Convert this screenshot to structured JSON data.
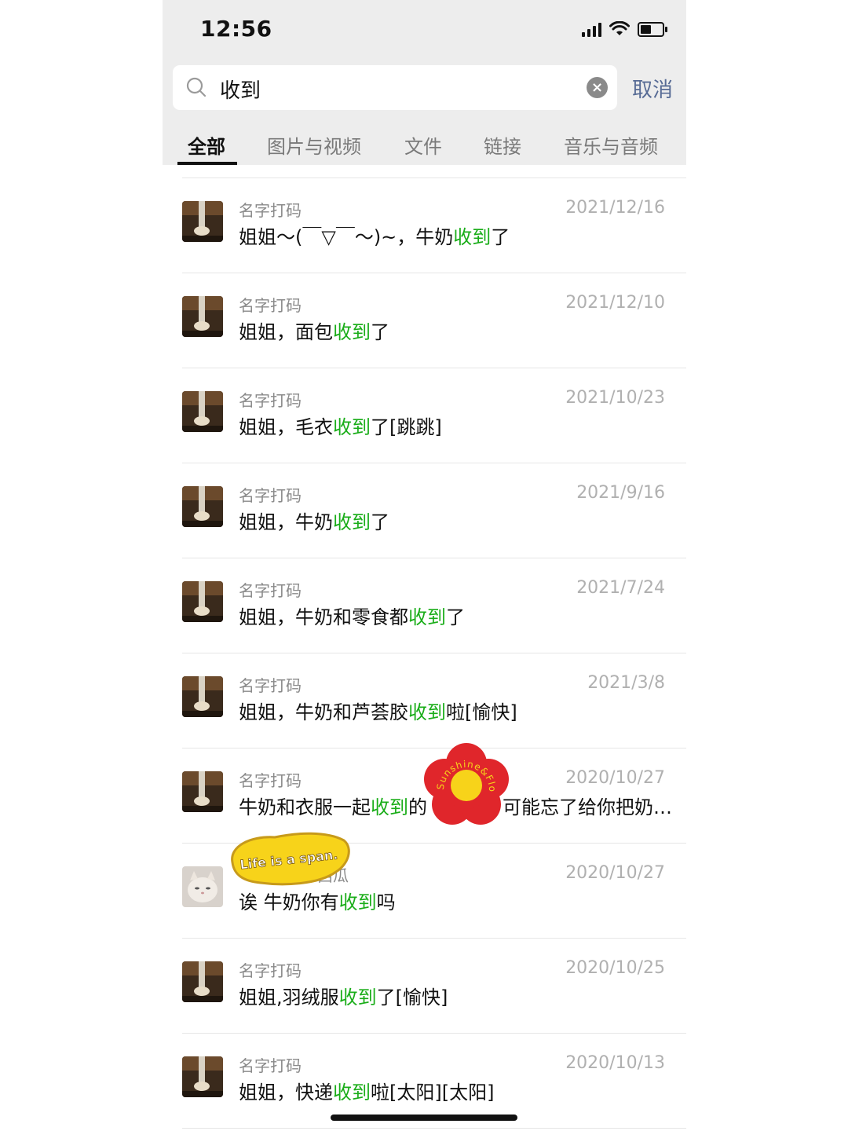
{
  "status_bar": {
    "time": "12:56"
  },
  "search": {
    "query": "收到",
    "cancel_label": "取消"
  },
  "tabs": [
    {
      "label": "全部",
      "active": true
    },
    {
      "label": "图片与视频",
      "active": false
    },
    {
      "label": "文件",
      "active": false
    },
    {
      "label": "链接",
      "active": false
    },
    {
      "label": "音乐与音频",
      "active": false
    }
  ],
  "results": [
    {
      "sender": "名字打码",
      "date": "2021/12/16",
      "pre": "姐姐～(￣▽￣～)~，牛奶",
      "hl": "收到",
      "post": "了",
      "avatar": "dark"
    },
    {
      "sender": "名字打码",
      "date": "2021/12/10",
      "pre": "姐姐，面包",
      "hl": "收到",
      "post": "了",
      "avatar": "dark"
    },
    {
      "sender": "名字打码",
      "date": "2021/10/23",
      "pre": "姐姐，毛衣",
      "hl": "收到",
      "post": "了[跳跳]",
      "avatar": "dark"
    },
    {
      "sender": "名字打码",
      "date": "2021/9/16",
      "pre": "姐姐，牛奶",
      "hl": "收到",
      "post": "了",
      "avatar": "dark"
    },
    {
      "sender": "名字打码",
      "date": "2021/7/24",
      "pre": "姐姐，牛奶和零食都",
      "hl": "收到",
      "post": "了",
      "avatar": "dark"
    },
    {
      "sender": "名字打码",
      "date": "2021/3/8",
      "pre": "姐姐，牛奶和芦荟胶",
      "hl": "收到",
      "post": "啦[愉快]",
      "avatar": "dark"
    },
    {
      "sender": "名字打码",
      "date": "2020/10/27",
      "pre": "牛奶和衣服一起",
      "hl": "收到",
      "post": "的　　　　可能忘了给你把奶…",
      "avatar": "dark"
    },
    {
      "sender": "　　　　　西瓜",
      "date": "2020/10/27",
      "pre": "诶 牛奶你有",
      "hl": "收到",
      "post": "吗",
      "avatar": "cat"
    },
    {
      "sender": "名字打码",
      "date": "2020/10/25",
      "pre": "姐姐,羽绒服",
      "hl": "收到",
      "post": "了[愉快]",
      "avatar": "dark"
    },
    {
      "sender": "名字打码",
      "date": "2020/10/13",
      "pre": "姐姐，快递",
      "hl": "收到",
      "post": "啦[太阳][太阳]",
      "avatar": "dark"
    }
  ],
  "stickers": {
    "flower_text": "Sunshine&Flower",
    "life_text": "Life is a span."
  },
  "colors": {
    "highlight": "#1aad19",
    "cancel": "#576b95",
    "header_bg": "#ededed",
    "sticker_red": "#e0262b",
    "sticker_yellow": "#f7d31a"
  }
}
